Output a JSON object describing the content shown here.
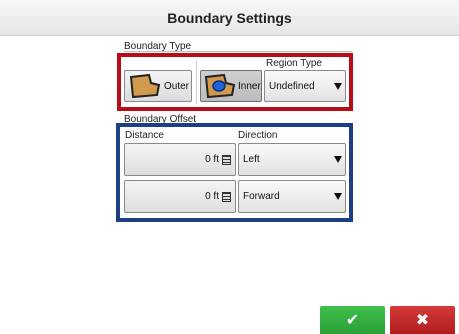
{
  "header": {
    "title": "Boundary Settings"
  },
  "boundary_type": {
    "label": "Boundary Type",
    "outer_label": "Outer",
    "inner_label": "Inner",
    "region_type_label": "Region Type",
    "region_type_value": "Undefined",
    "selected": "Inner"
  },
  "boundary_offset": {
    "label": "Boundary Offset",
    "distance_header": "Distance",
    "direction_header": "Direction",
    "rows": [
      {
        "distance": "0 ft",
        "direction": "Left"
      },
      {
        "distance": "0 ft",
        "direction": "Forward"
      }
    ]
  },
  "footer": {
    "ok_icon": "checkmark-icon",
    "cancel_icon": "close-icon"
  },
  "colors": {
    "ok": "#2fae3a",
    "cancel": "#c32626",
    "red_frame": "#b80d17",
    "blue_frame": "#1d3f86"
  }
}
